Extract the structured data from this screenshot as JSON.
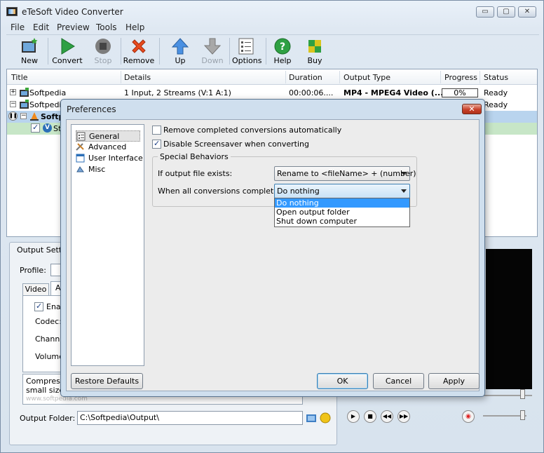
{
  "app": {
    "title": "eTeSoft Video Converter"
  },
  "window_controls": {
    "minimize": "▭",
    "restore": "▢",
    "close": "✕"
  },
  "menu": [
    "File",
    "Edit",
    "Preview",
    "Tools",
    "Help"
  ],
  "toolbar": {
    "new": "New",
    "convert": "Convert",
    "stop": "Stop",
    "remove": "Remove",
    "up": "Up",
    "down": "Down",
    "options": "Options",
    "help": "Help",
    "buy": "Buy"
  },
  "list": {
    "columns": [
      "Title",
      "Details",
      "Duration",
      "Output Type",
      "Progress",
      "Status"
    ],
    "rows": [
      {
        "title": "Softpedia",
        "details": "1 Input, 2 Streams (V:1 A:1)",
        "duration": "00:00:06....",
        "output_type": "MP4 - MPEG4 Video (...",
        "progress": "0%",
        "status": "Ready"
      },
      {
        "title": "Softpedia",
        "status": "Ready"
      },
      {
        "title": "Softpe"
      },
      {
        "title": "Str"
      }
    ]
  },
  "bottom": {
    "output_settings": "Output Setti",
    "profile_label": "Profile:",
    "tab_video": "Video",
    "tab_audio": "Au",
    "enable": "Enab",
    "codec": "Codec:",
    "channels": "Channels",
    "volume": "Volume:",
    "compression_line1": "Compressio",
    "compression_line2": "small size ar",
    "watermark": "www.softpedia.com",
    "output_folder_label": "Output Folder:",
    "output_folder_value": "C:\\Softpedia\\Output\\"
  },
  "dialog": {
    "title": "Preferences",
    "close": "✕",
    "tree": [
      "General",
      "Advanced",
      "User Interface",
      "Misc"
    ],
    "remove_completed": "Remove completed conversions automatically",
    "remove_completed_checked": false,
    "disable_screensaver": "Disable Screensaver when converting",
    "disable_screensaver_checked": true,
    "special_behaviors": "Special Behaviors",
    "if_exists_label": "If output file exists:",
    "if_exists_value": "Rename to <fileName> + (number)",
    "when_completed_label": "When all conversions completed:",
    "when_completed_value": "Do nothing",
    "dropdown_options": [
      "Do nothing",
      "Open output folder",
      "Shut down computer"
    ],
    "restore_defaults": "Restore Defaults",
    "ok": "OK",
    "cancel": "Cancel",
    "apply": "Apply"
  },
  "colors": {
    "selection": "#3399ff",
    "row_highlight_blue": "#b9d4ee",
    "row_highlight_green": "#c7e6c7"
  }
}
